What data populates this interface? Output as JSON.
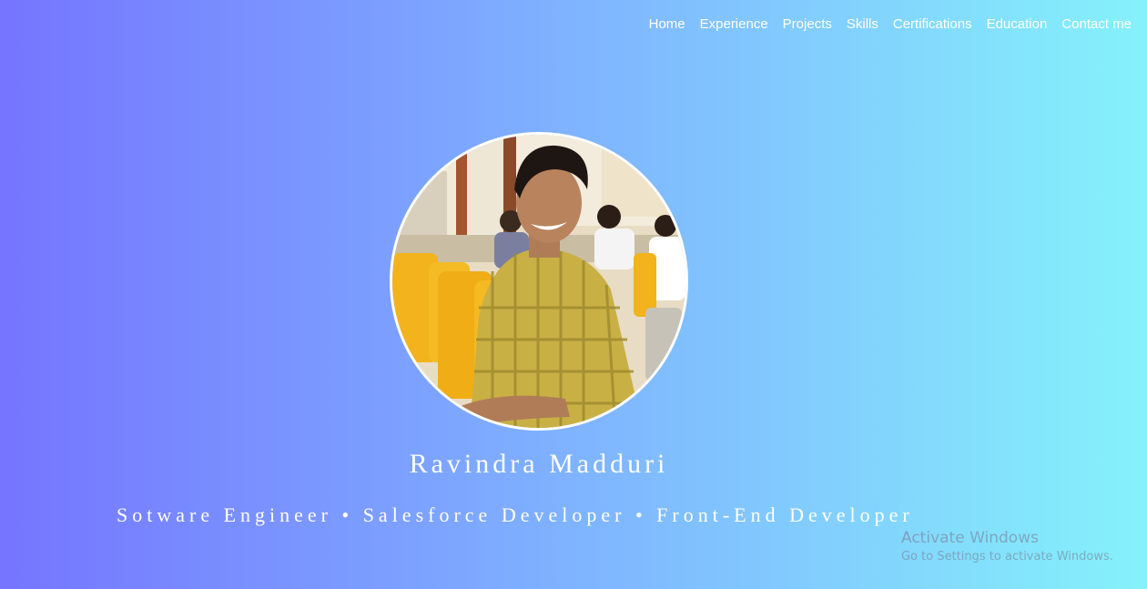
{
  "nav": {
    "items": [
      {
        "label": "Home"
      },
      {
        "label": "Experience"
      },
      {
        "label": "Projects"
      },
      {
        "label": "Skills"
      },
      {
        "label": "Certifications"
      },
      {
        "label": "Education"
      },
      {
        "label": "Contact me"
      }
    ]
  },
  "hero": {
    "name": "Ravindra Madduri",
    "roles": "Sotware Engineer • Salesforce Developer • Front-End Developer",
    "avatar": "profile-photo"
  },
  "watermark": {
    "title": "Activate Windows",
    "subtitle": "Go to Settings to activate Windows."
  },
  "colors": {
    "gradient_start": "#7575ff",
    "gradient_mid": "#7fb3ff",
    "gradient_end": "#85f2fb",
    "text": "#ffffff"
  }
}
